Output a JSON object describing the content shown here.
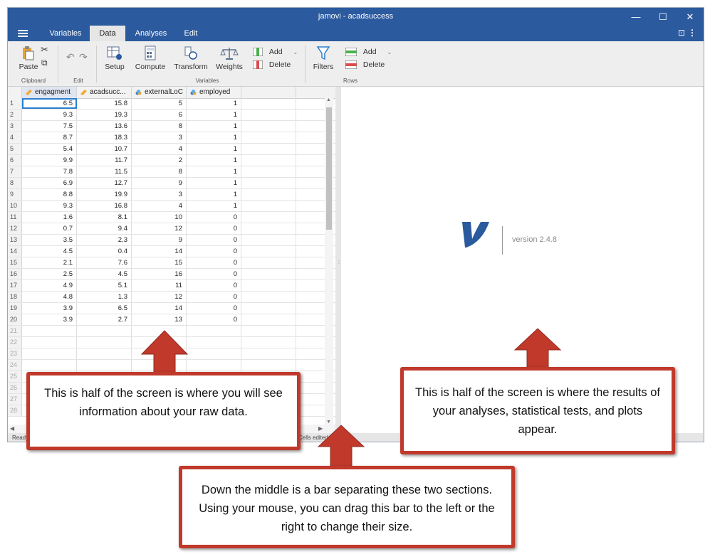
{
  "window": {
    "title": "jamovi - acadsuccess",
    "controls": [
      "—",
      "☐",
      "✕"
    ]
  },
  "menu": {
    "tabs": [
      "Variables",
      "Data",
      "Analyses",
      "Edit"
    ],
    "active_tab": "Data"
  },
  "ribbon": {
    "paste_label": "Paste",
    "clipboard_group": "Clipboard",
    "edit_group": "Edit",
    "setup_label": "Setup",
    "compute_label": "Compute",
    "transform_label": "Transform",
    "weights_label": "Weights",
    "var_add_label": "Add",
    "var_delete_label": "Delete",
    "variables_group": "Variables",
    "filters_label": "Filters",
    "row_add_label": "Add",
    "row_delete_label": "Delete",
    "rows_group": "Rows"
  },
  "sheet": {
    "columns": [
      {
        "name": "engagment",
        "type": "continuous"
      },
      {
        "name": "acadsucc...",
        "type": "continuous"
      },
      {
        "name": "externalLoC",
        "type": "nominal"
      },
      {
        "name": "employed",
        "type": "nominal"
      }
    ],
    "rows": [
      [
        "6.5",
        "15.8",
        "5",
        "1"
      ],
      [
        "9.3",
        "19.3",
        "6",
        "1"
      ],
      [
        "7.5",
        "13.6",
        "8",
        "1"
      ],
      [
        "8.7",
        "18.3",
        "3",
        "1"
      ],
      [
        "5.4",
        "10.7",
        "4",
        "1"
      ],
      [
        "9.9",
        "11.7",
        "2",
        "1"
      ],
      [
        "7.8",
        "11.5",
        "8",
        "1"
      ],
      [
        "6.9",
        "12.7",
        "9",
        "1"
      ],
      [
        "8.8",
        "19.9",
        "3",
        "1"
      ],
      [
        "9.3",
        "16.8",
        "4",
        "1"
      ],
      [
        "1.6",
        "8.1",
        "10",
        "0"
      ],
      [
        "0.7",
        "9.4",
        "12",
        "0"
      ],
      [
        "3.5",
        "2.3",
        "9",
        "0"
      ],
      [
        "4.5",
        "0.4",
        "14",
        "0"
      ],
      [
        "2.1",
        "7.6",
        "15",
        "0"
      ],
      [
        "2.5",
        "4.5",
        "16",
        "0"
      ],
      [
        "4.9",
        "5.1",
        "11",
        "0"
      ],
      [
        "4.8",
        "1.3",
        "12",
        "0"
      ],
      [
        "3.9",
        "6.5",
        "14",
        "0"
      ],
      [
        "3.9",
        "2.7",
        "13",
        "0"
      ]
    ],
    "empty_rows": [
      "21",
      "22",
      "23",
      "24",
      "25",
      "26",
      "27",
      "28"
    ]
  },
  "status": {
    "left": "Ready",
    "right": "Cells edited 0"
  },
  "results": {
    "version": "version 2.4.8"
  },
  "callouts": {
    "left": "This is half of the screen is where you will see information about your raw data.",
    "right": "This is half of the screen is where the results of your analyses, statistical tests, and plots appear.",
    "bottom": "Down the middle is a bar separating these two sections. Using your mouse, you can drag this bar to the left or the right to change their size."
  },
  "colors": {
    "titlebar": "#2b5a9e",
    "callout_border": "#c0392b",
    "logo": "#2b5a9e"
  }
}
